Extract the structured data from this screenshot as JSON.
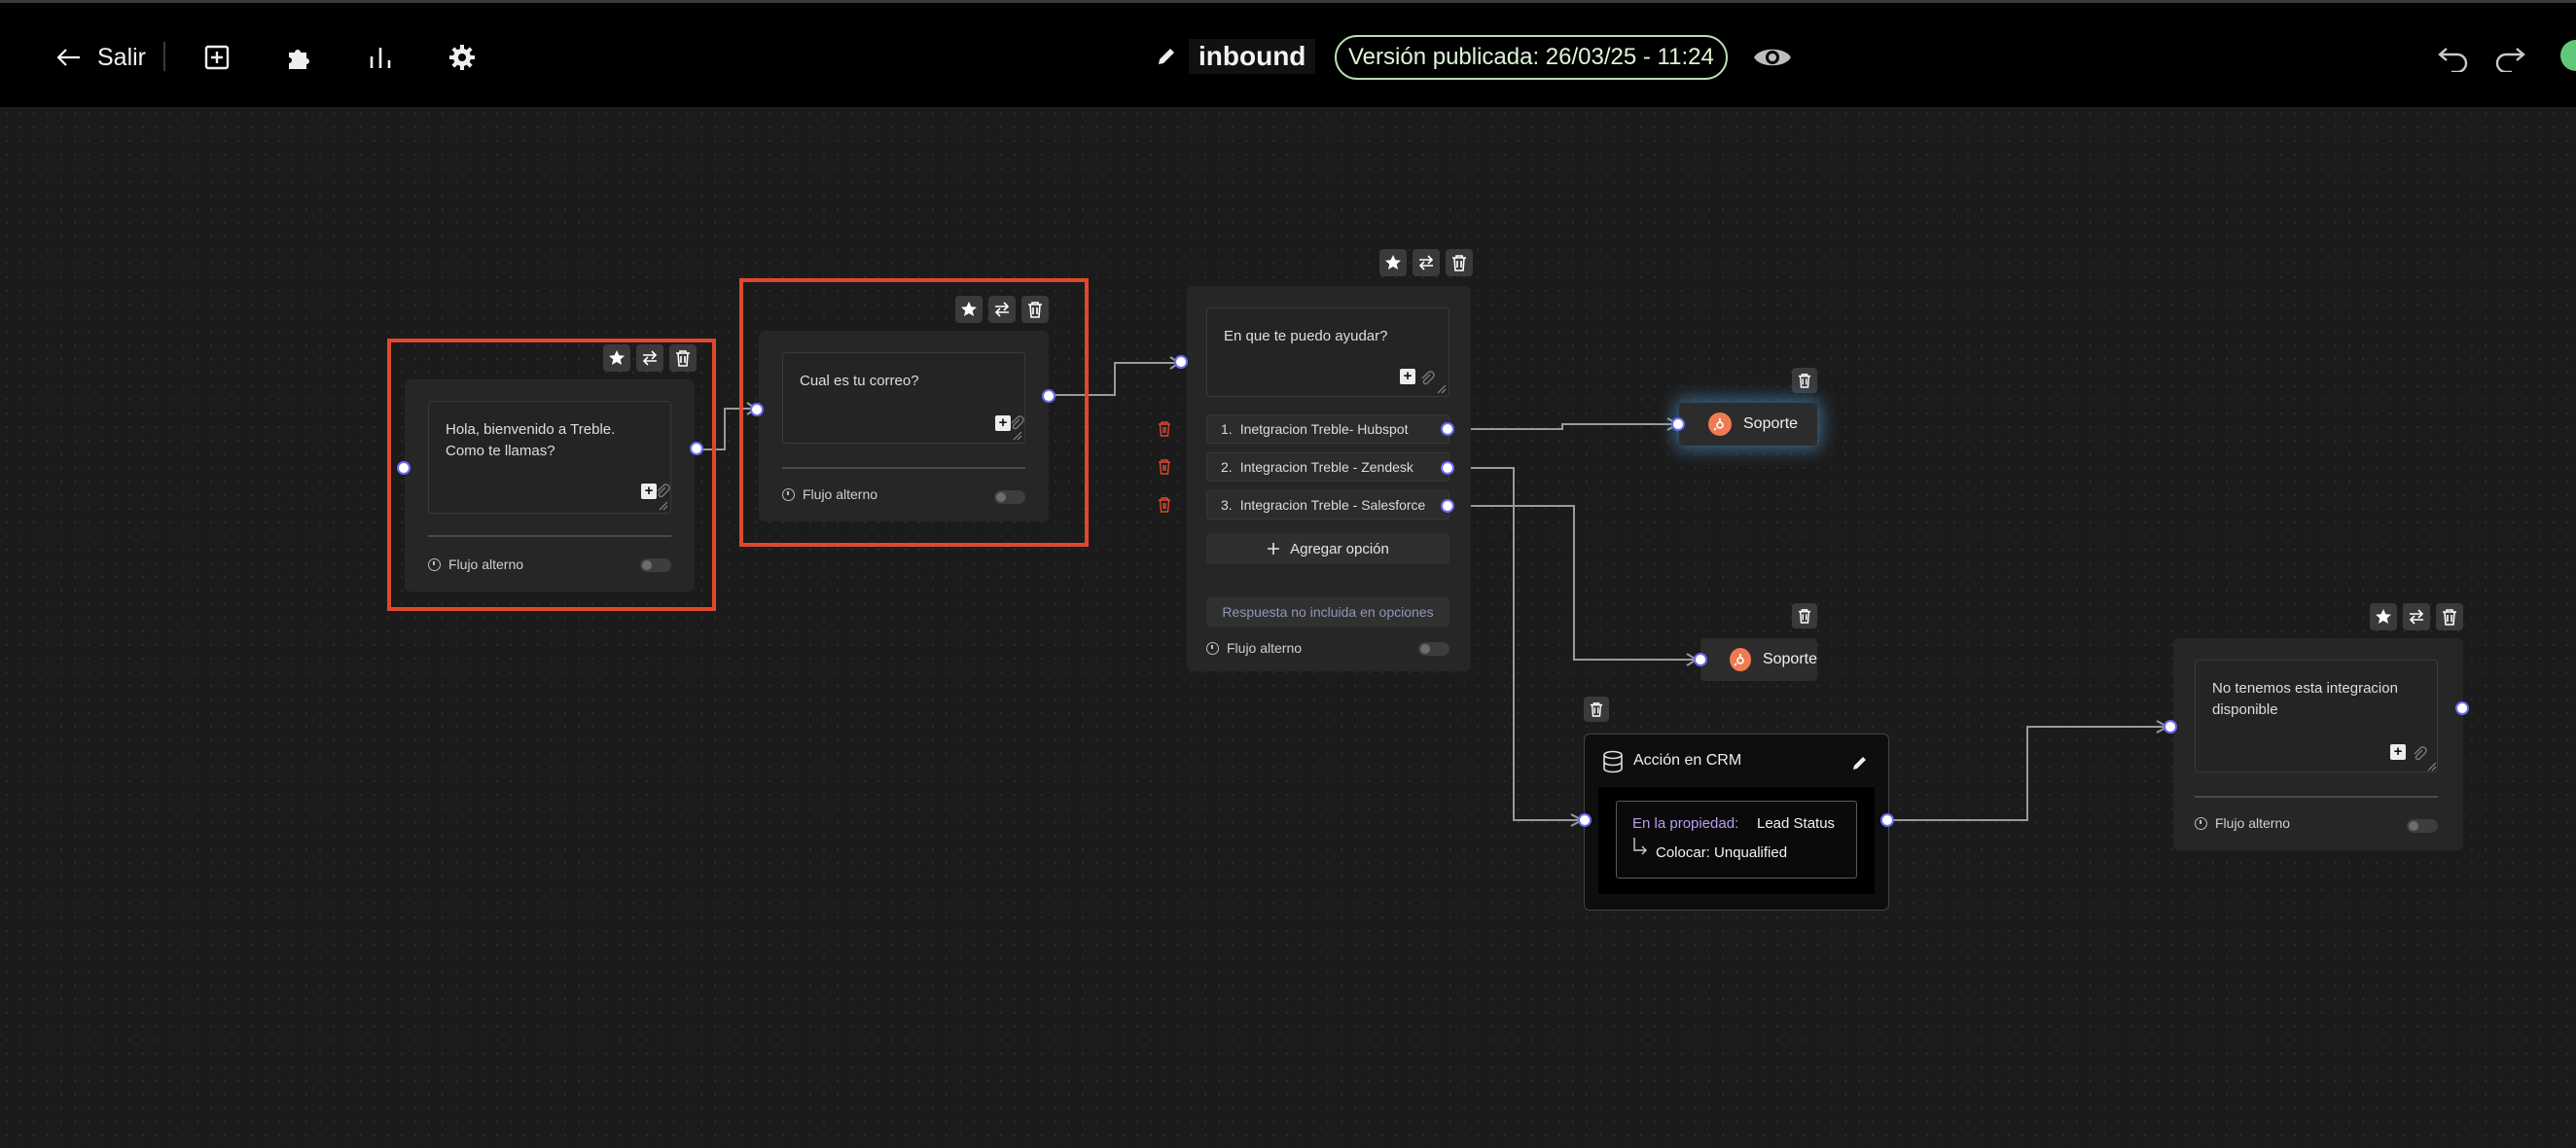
{
  "topbar": {
    "exit_label": "Salir",
    "flow_title": "inbound",
    "published_version": "Versión publicada: 26/03/25 - 11:24",
    "icons": [
      "add-square-icon",
      "puzzle-icon",
      "bar-chart-icon",
      "gear-icon",
      "pencil-icon",
      "eye-icon",
      "undo-icon",
      "redo-icon"
    ]
  },
  "nodes": {
    "greeting": {
      "text": "Hola, bienvenido a Treble.\nComo te llamas?",
      "alt_flow": "Flujo alterno"
    },
    "email": {
      "text": "Cual es tu correo?",
      "alt_flow": "Flujo alterno"
    },
    "help": {
      "text": "En que te puedo ayudar?",
      "options": [
        {
          "num": "1.",
          "label": "Inetgracion Treble- Hubspot"
        },
        {
          "num": "2.",
          "label": "Integracion Treble - Zendesk"
        },
        {
          "num": "3.",
          "label": "Integracion Treble - Salesforce"
        }
      ],
      "add_option": "Agregar opción",
      "no_option": "Respuesta no incluida en opciones",
      "alt_flow": "Flujo alterno"
    },
    "support_1": {
      "label": "Soporte"
    },
    "support_2": {
      "label": "Soporte"
    },
    "crm": {
      "title": "Acción en CRM",
      "property_label": "En la propiedad:",
      "property_value": "Lead Status",
      "set_value": "Colocar: Unqualified"
    },
    "unavailable": {
      "text": "No tenemos esta integracion\ndisponible",
      "alt_flow": "Flujo alterno"
    }
  },
  "colors": {
    "highlight": "#e0482c",
    "port_ring": "#6a6af0",
    "badge_border": "#b8e0b0",
    "hubspot": "#f07b52",
    "crm_property": "#b79cf0"
  }
}
